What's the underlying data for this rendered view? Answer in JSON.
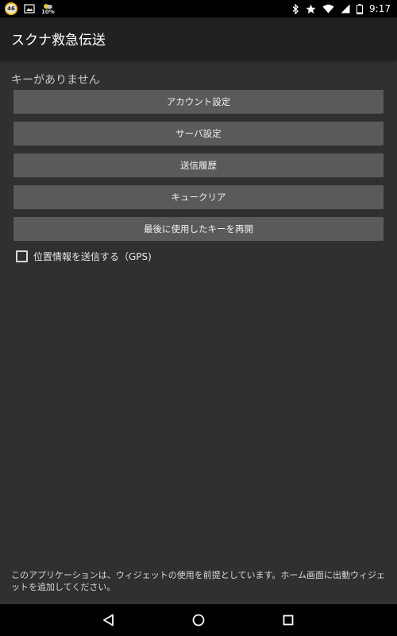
{
  "status_bar": {
    "badge_number": "46",
    "battery_percent_label": "10%",
    "time": "9:17",
    "icons": [
      "notification-badge-icon",
      "image-icon",
      "weather-icon",
      "bluetooth-icon",
      "star-icon",
      "wifi-icon",
      "signal-icon",
      "battery-icon"
    ]
  },
  "action_bar": {
    "title": "スクナ救急伝送"
  },
  "main": {
    "key_status": "キーがありません",
    "buttons": {
      "account": "アカウント設定",
      "server": "サーバ設定",
      "history": "送信履歴",
      "queue_clear": "キュークリア",
      "resume_last_key": "最後に使用したキーを再開"
    },
    "gps_checkbox": {
      "label": "位置情報を送信する（GPS)",
      "checked": false
    },
    "footer_note": "このアプリケーションは、ウィジェットの使用を前提としています。ホーム画面に出動ウィジェットを追加してください。"
  },
  "navigation": {
    "icons": [
      "back-icon",
      "home-icon",
      "recents-icon"
    ]
  },
  "colors": {
    "background": "#303030",
    "action_bar": "#212121",
    "button": "#5a5a5a",
    "status_bar": "#000000"
  }
}
